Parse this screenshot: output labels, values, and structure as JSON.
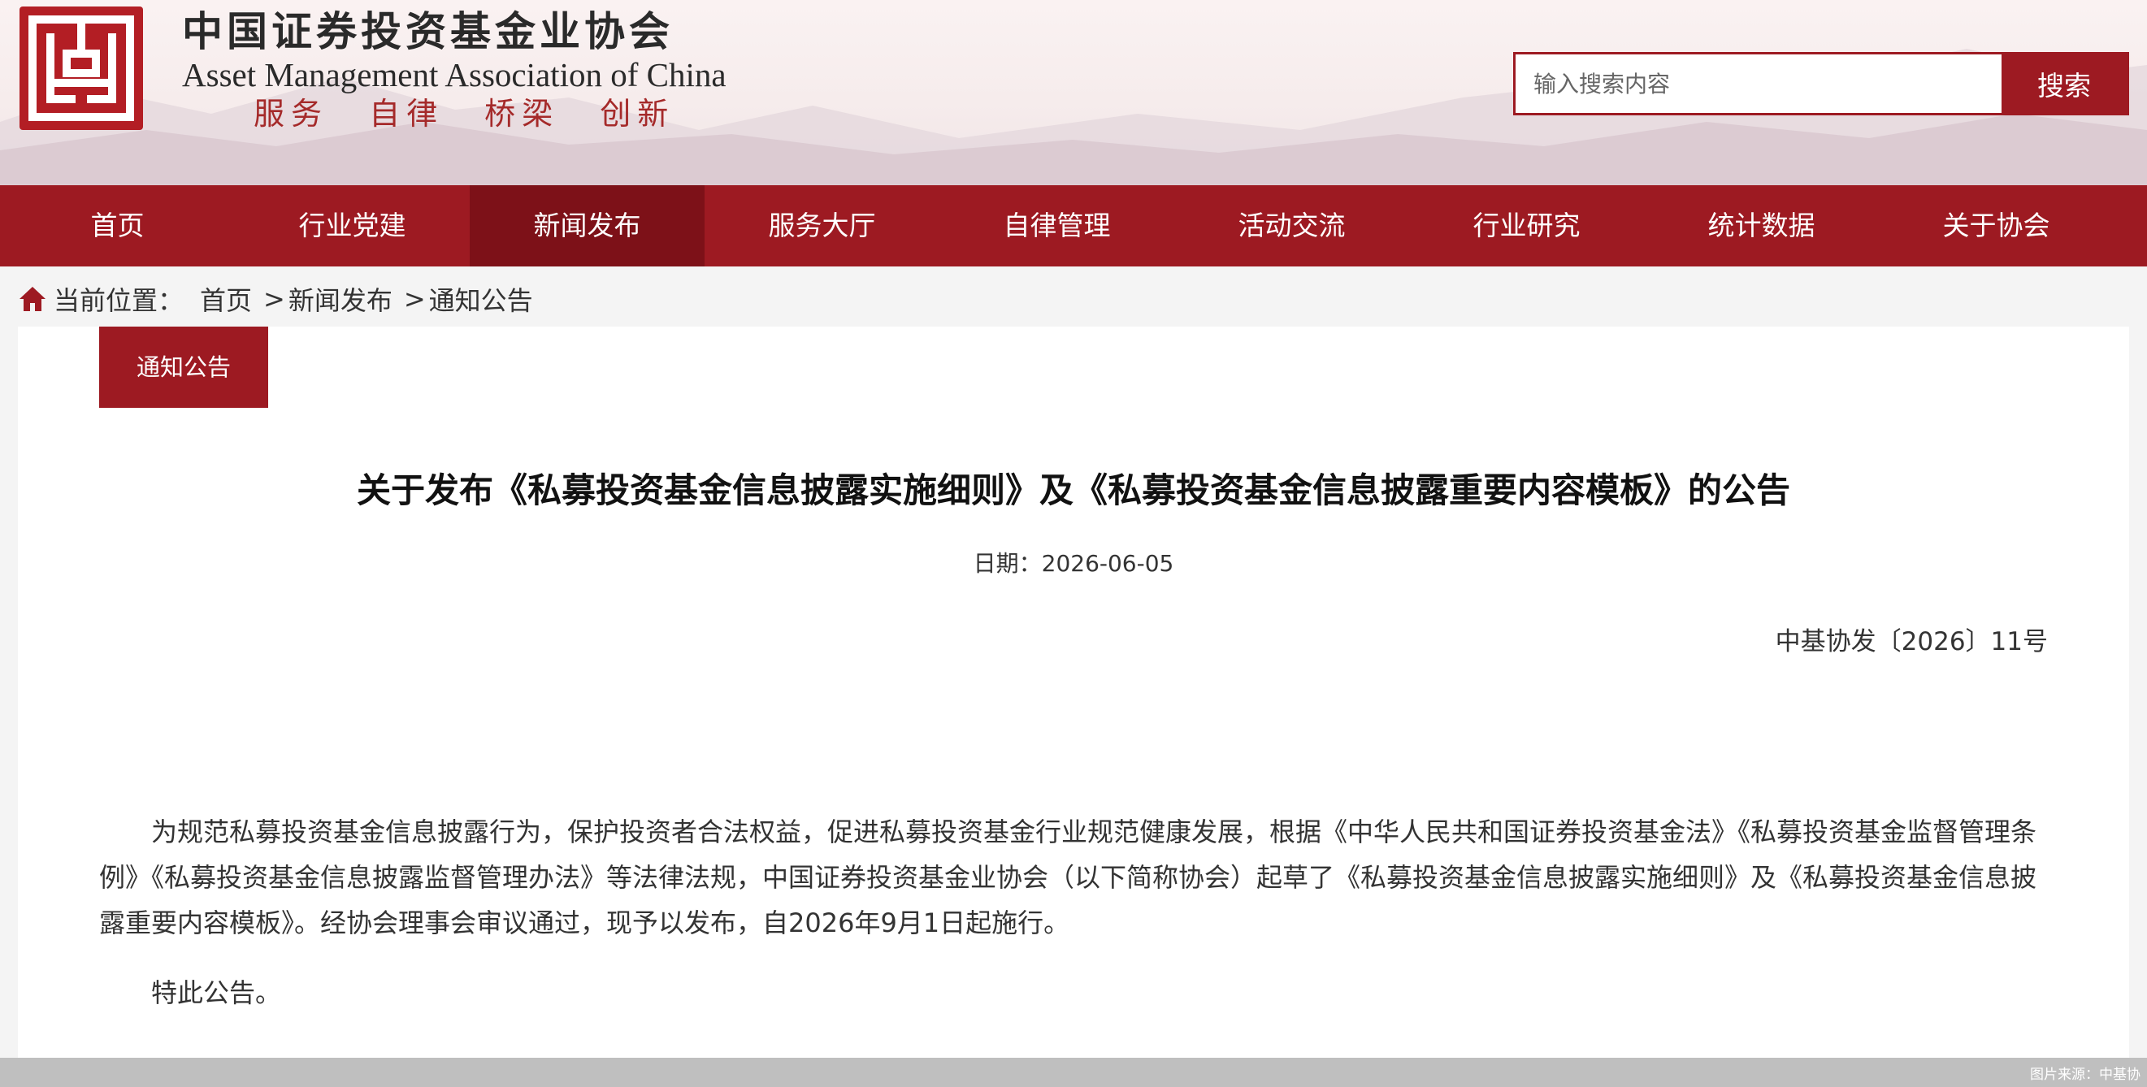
{
  "header": {
    "org_name_cn": "中国证券投资基金业协会",
    "org_name_en": "Asset Management Association of China",
    "slogan": "服务 自律 桥梁 创新",
    "brand_color": "#9d1a22",
    "search": {
      "placeholder": "输入搜索内容",
      "value": "",
      "button_label": "搜索"
    }
  },
  "nav": {
    "items": [
      {
        "label": "首页",
        "active": false
      },
      {
        "label": "行业党建",
        "active": false
      },
      {
        "label": "新闻发布",
        "active": true
      },
      {
        "label": "服务大厅",
        "active": false
      },
      {
        "label": "自律管理",
        "active": false
      },
      {
        "label": "活动交流",
        "active": false
      },
      {
        "label": "行业研究",
        "active": false
      },
      {
        "label": "统计数据",
        "active": false
      },
      {
        "label": "关于协会",
        "active": false
      }
    ]
  },
  "breadcrumb": {
    "icon": "home-icon",
    "prefix": "当前位置：",
    "items": [
      "首页",
      "新闻发布",
      "通知公告"
    ],
    "separator": ">"
  },
  "section_tab": "通知公告",
  "article": {
    "title": "关于发布《私募投资基金信息披露实施细则》及《私募投资基金信息披露重要内容模板》的公告",
    "date": "日期：2026-06-05",
    "doc_number": "中基协发〔2026〕11号",
    "paragraphs": [
      "为规范私募投资基金信息披露行为，保护投资者合法权益，促进私募投资基金行业规范健康发展，根据《中华人民共和国证券投资基金法》《私募投资基金监督管理条例》《私募投资基金信息披露监督管理办法》等法律法规，中国证券投资基金业协会（以下简称协会）起草了《私募投资基金信息披露实施细则》及《私募投资基金信息披露重要内容模板》。经协会理事会审议通过，现予以发布，自2026年9月1日起施行。",
      "特此公告。"
    ]
  },
  "footer": {
    "image_source": "图片来源：中基协"
  }
}
